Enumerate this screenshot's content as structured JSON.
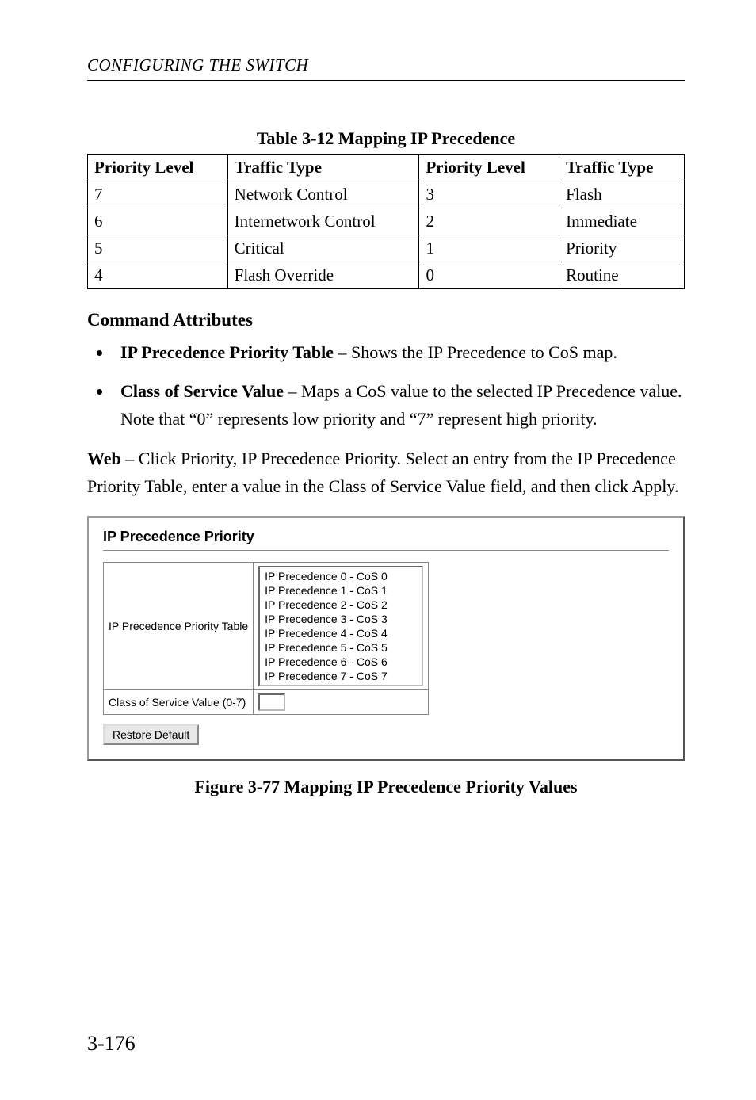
{
  "running_head": "CONFIGURING THE SWITCH",
  "table_caption": "Table 3-12  Mapping IP Precedence",
  "table": {
    "headers": [
      "Priority Level",
      "Traffic Type",
      "Priority Level",
      "Traffic Type"
    ],
    "rows": [
      [
        "7",
        "Network Control",
        "3",
        "Flash"
      ],
      [
        "6",
        "Internetwork Control",
        "2",
        "Immediate"
      ],
      [
        "5",
        "Critical",
        "1",
        "Priority"
      ],
      [
        "4",
        "Flash Override",
        "0",
        "Routine"
      ]
    ]
  },
  "section_head": "Command Attributes",
  "bullets": [
    {
      "bold": "IP Precedence Priority Table",
      "text": " – Shows the IP Precedence to CoS map."
    },
    {
      "bold": "Class of Service Value",
      "text": " – Maps a CoS value to the selected IP Precedence value. Note that “0” represents low priority and “7” represent high priority."
    }
  ],
  "web_para": {
    "lead_bold": "Web",
    "rest": " – Click Priority, IP Precedence Priority. Select an entry from the IP Precedence Priority Table, enter a value in the Class of Service Value field, and then click Apply."
  },
  "ui": {
    "title": "IP Precedence Priority",
    "row1_label": "IP Precedence Priority Table",
    "listbox_items": [
      "IP Precedence 0 - CoS 0",
      "IP Precedence 1 - CoS 1",
      "IP Precedence 2 - CoS 2",
      "IP Precedence 3 - CoS 3",
      "IP Precedence 4 - CoS 4",
      "IP Precedence 5 - CoS 5",
      "IP Precedence 6 - CoS 6",
      "IP Precedence 7 - CoS 7"
    ],
    "row2_label": "Class of Service Value (0-7)",
    "input_value": "",
    "button_label": "Restore Default"
  },
  "fig_caption": "Figure 3-77  Mapping IP Precedence Priority Values",
  "page_number": "3-176",
  "chart_data": {
    "type": "table",
    "title": "Mapping IP Precedence",
    "columns": [
      "Priority Level",
      "Traffic Type"
    ],
    "rows": [
      {
        "Priority Level": 7,
        "Traffic Type": "Network Control"
      },
      {
        "Priority Level": 6,
        "Traffic Type": "Internetwork Control"
      },
      {
        "Priority Level": 5,
        "Traffic Type": "Critical"
      },
      {
        "Priority Level": 4,
        "Traffic Type": "Flash Override"
      },
      {
        "Priority Level": 3,
        "Traffic Type": "Flash"
      },
      {
        "Priority Level": 2,
        "Traffic Type": "Immediate"
      },
      {
        "Priority Level": 1,
        "Traffic Type": "Priority"
      },
      {
        "Priority Level": 0,
        "Traffic Type": "Routine"
      }
    ]
  }
}
